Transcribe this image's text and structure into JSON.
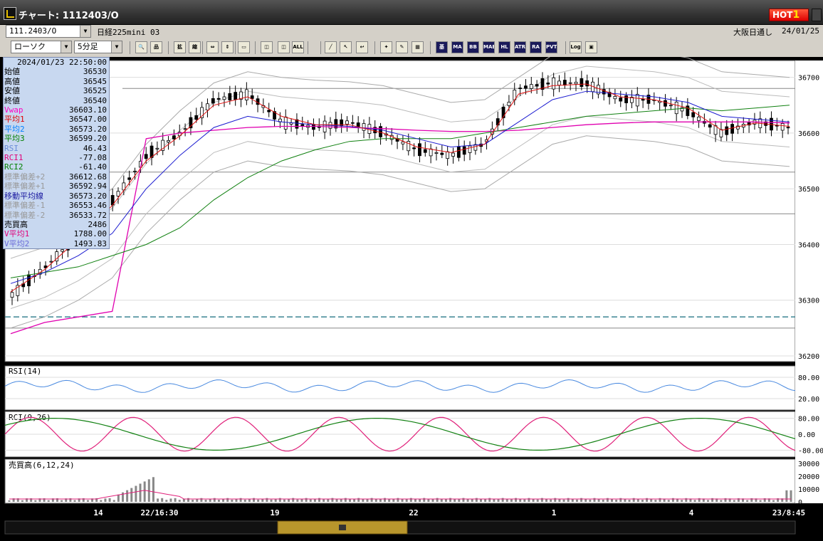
{
  "window": {
    "title": "チャート: 1112403/O",
    "hot_label": "HOT",
    "hot_num": "1"
  },
  "toolbar1": {
    "symbol": "111.2403/O",
    "name": "日経225mini 03",
    "exchange": "大阪日通し",
    "date": "24/01/25"
  },
  "toolbar2": {
    "chart_type": "ローソク",
    "interval": "5分足",
    "tools": [
      "🔍",
      "品",
      "拡",
      "縮",
      "⇔",
      "⇕",
      "▭",
      "◫",
      "◫",
      "ALL",
      "╱",
      "↖",
      "↩",
      "✦",
      "✎",
      "▦",
      "基",
      "MA",
      "BB",
      "MAE",
      "HL",
      "ATR",
      "RA",
      "PVT",
      "Log",
      "▣"
    ]
  },
  "info": {
    "datetime": "2024/01/23  22:50:00",
    "rows": [
      {
        "k": "始値",
        "v": "36530",
        "c": "#000"
      },
      {
        "k": "高値",
        "v": "36545",
        "c": "#000"
      },
      {
        "k": "安値",
        "v": "36525",
        "c": "#000"
      },
      {
        "k": "終値",
        "v": "36540",
        "c": "#000"
      },
      {
        "k": "Vwap",
        "v": "36603.10",
        "c": "#ff00c0"
      },
      {
        "k": "平均1",
        "v": "36547.00",
        "c": "#e00000"
      },
      {
        "k": "平均2",
        "v": "36573.20",
        "c": "#0080ff"
      },
      {
        "k": "平均3",
        "v": "36599.20",
        "c": "#008000"
      },
      {
        "k": "RSI",
        "v": "46.43",
        "c": "#6a8cd8"
      },
      {
        "k": "RCI1",
        "v": "-77.08",
        "c": "#e0007a"
      },
      {
        "k": "RCI2",
        "v": "-61.40",
        "c": "#008000"
      },
      {
        "k": "標準偏差+2",
        "v": "36612.68",
        "c": "#999"
      },
      {
        "k": "標準偏差+1",
        "v": "36592.94",
        "c": "#999"
      },
      {
        "k": "移動平均線",
        "v": "36573.20",
        "c": "#1a1aa0"
      },
      {
        "k": "標準偏差-1",
        "v": "36553.46",
        "c": "#999"
      },
      {
        "k": "標準偏差-2",
        "v": "36533.72",
        "c": "#999"
      },
      {
        "k": "売買高",
        "v": "2486",
        "c": "#000"
      },
      {
        "k": "V平均1",
        "v": "1788.00",
        "c": "#e0007a"
      },
      {
        "k": "V平均2",
        "v": "1493.83",
        "c": "#6a6ad8"
      }
    ]
  },
  "chart_data": {
    "type": "line",
    "title": "日経225mini 03",
    "price_axis": {
      "ticks": [
        "36700",
        "36600",
        "36500",
        "36400",
        "36300",
        "36200"
      ]
    },
    "price_series": {
      "x_count": 24,
      "close": [
        36310,
        36360,
        36420,
        36480,
        36560,
        36600,
        36660,
        36670,
        36620,
        36610,
        36620,
        36600,
        36570,
        36560,
        36580,
        36680,
        36690,
        36690,
        36660,
        36660,
        36640,
        36600,
        36620,
        36610
      ],
      "ma_fast": [
        36315,
        36355,
        36410,
        36470,
        36550,
        36595,
        36650,
        36665,
        36630,
        36615,
        36615,
        36600,
        36575,
        36565,
        36580,
        36670,
        36685,
        36688,
        36665,
        36660,
        36645,
        36605,
        36618,
        36612
      ],
      "ma_mid": [
        36330,
        36350,
        36380,
        36420,
        36500,
        36560,
        36610,
        36630,
        36620,
        36615,
        36612,
        36605,
        36590,
        36575,
        36580,
        36620,
        36660,
        36675,
        36670,
        36665,
        36655,
        36630,
        36625,
        36620
      ],
      "ma_slow": [
        36340,
        36350,
        36360,
        36380,
        36400,
        36430,
        36480,
        36520,
        36550,
        36570,
        36585,
        36590,
        36590,
        36590,
        36600,
        36610,
        36620,
        36630,
        36635,
        36640,
        36645,
        36640,
        36645,
        36650
      ],
      "vwap": [
        36240,
        36260,
        36270,
        36280,
        36590,
        36600,
        36605,
        36610,
        36612,
        36612,
        36610,
        36608,
        36605,
        36603,
        36603,
        36605,
        36610,
        36615,
        36618,
        36620,
        36620,
        36620,
        36620,
        36618
      ]
    },
    "sub_panels": [
      {
        "name": "RSI(14)",
        "ticks": [
          "80.00",
          "20.00"
        ]
      },
      {
        "name": "RCI(9,26)",
        "ticks": [
          "80.00",
          "0.00",
          "-80.00"
        ]
      },
      {
        "name": "売買高(6,12,24)",
        "ticks": [
          "30000",
          "20000",
          "10000",
          "0"
        ]
      }
    ],
    "x_ticks": [
      "14",
      "22/16:30",
      "19",
      "22",
      "1",
      "4",
      "23/8:45"
    ]
  }
}
